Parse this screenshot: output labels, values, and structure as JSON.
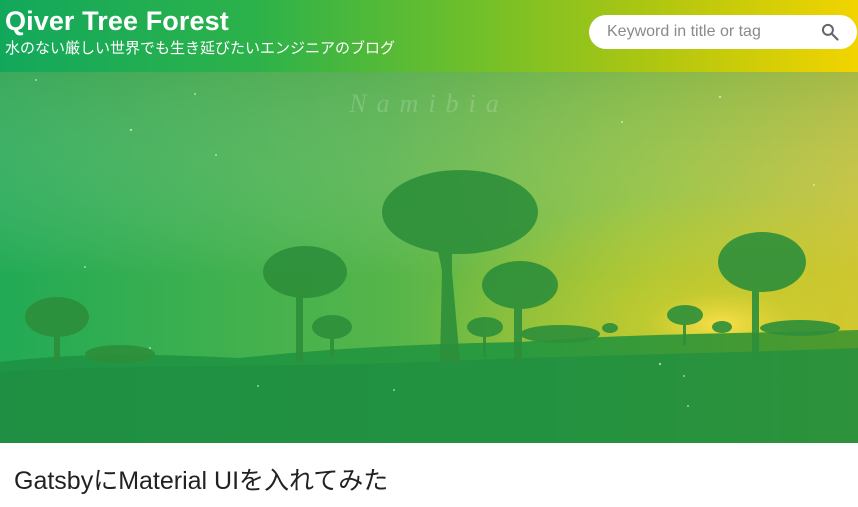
{
  "site": {
    "title": "Qiver Tree Forest",
    "subtitle": "水のない厳しい世界でも生き延びたいエンジニアのブログ"
  },
  "search": {
    "placeholder": "Keyword in title or tag",
    "value": "",
    "icon": "search-icon"
  },
  "hero": {
    "watermark": "Namibia"
  },
  "post": {
    "title": "GatsbyにMaterial UIを入れてみた"
  },
  "colors": {
    "header_gradient_start": "#12a85c",
    "header_gradient_end": "#f2d400",
    "text_dark": "#222222"
  }
}
